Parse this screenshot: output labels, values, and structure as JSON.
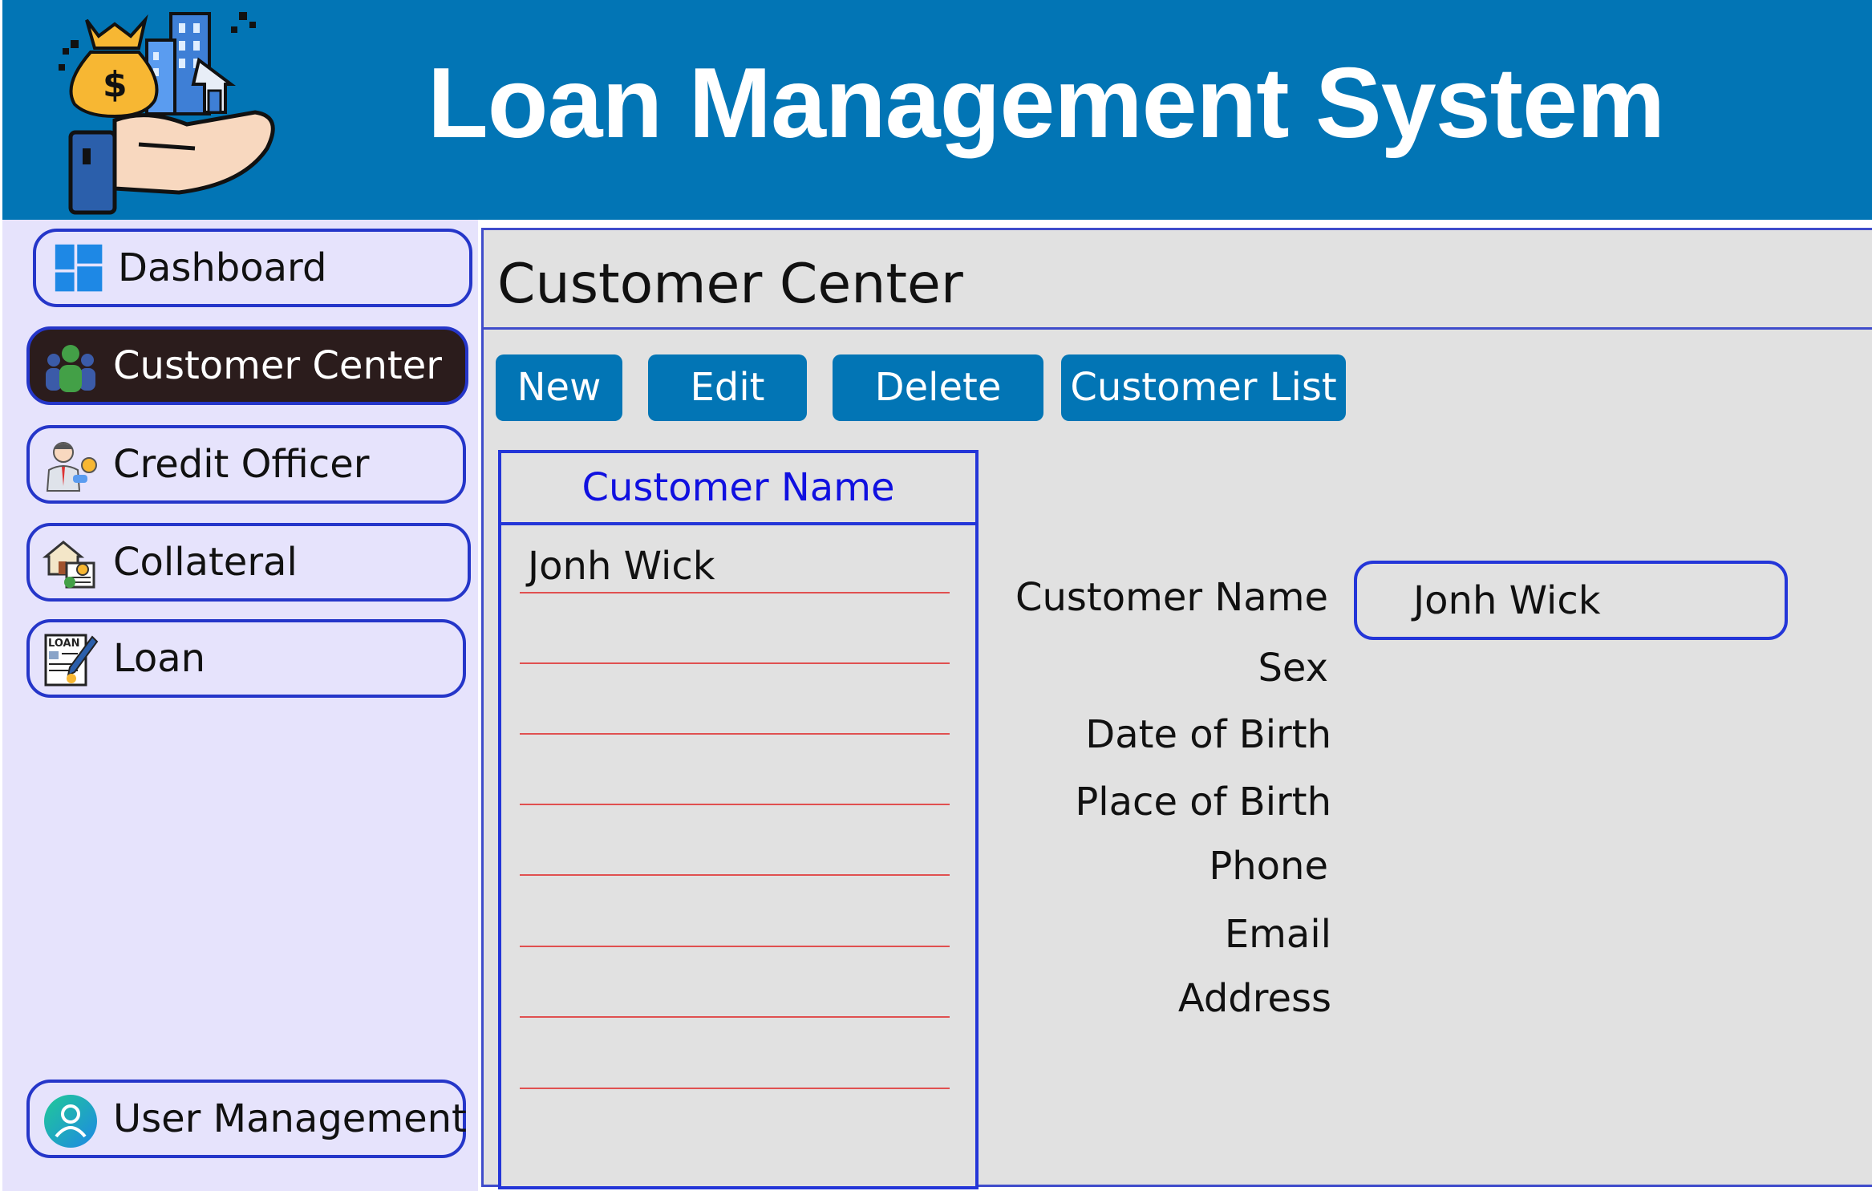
{
  "header": {
    "title": "Loan Management System",
    "logo_icon": "money-bag-hand-house-icon",
    "logo_lettering": "$",
    "background": "#0275b5"
  },
  "sidebar": {
    "background": "#e6e3fc",
    "items": [
      {
        "label": "Dashboard",
        "icon": "dashboard-icon",
        "active": false
      },
      {
        "label": "Customer Center",
        "icon": "customer-group-icon",
        "active": true
      },
      {
        "label": "Credit Officer",
        "icon": "credit-officer-icon",
        "active": false
      },
      {
        "label": "Collateral",
        "icon": "collateral-icon",
        "active": false
      },
      {
        "label": "Loan",
        "icon": "loan-document-icon",
        "icon_lettering": "LOAN",
        "active": false
      }
    ],
    "bottom_item": {
      "label": "User Management",
      "icon": "user-icon"
    }
  },
  "main": {
    "title": "Customer Center",
    "toolbar": {
      "new_label": "New",
      "edit_label": "Edit",
      "delete_label": "Delete",
      "customer_list_label": "Customer List"
    },
    "list": {
      "header": "Customer Name",
      "rows": [
        "Jonh Wick",
        "",
        "",
        "",
        "",
        "",
        "",
        ""
      ]
    },
    "form": {
      "labels": {
        "customer_name": "Customer Name",
        "sex": "Sex",
        "date_of_birth": "Date of Birth",
        "place_of_birth": "Place of Birth",
        "phone": "Phone",
        "email": "Email",
        "address": "Address"
      },
      "customer_name_value": "Jonh Wick"
    }
  },
  "colors": {
    "accent": "#0275b5",
    "border": "#2436d8",
    "active_nav": "#2b1c1c",
    "list_header_text": "#1010e0",
    "row_line": "#e05050",
    "panel": "#e1e1e1"
  }
}
